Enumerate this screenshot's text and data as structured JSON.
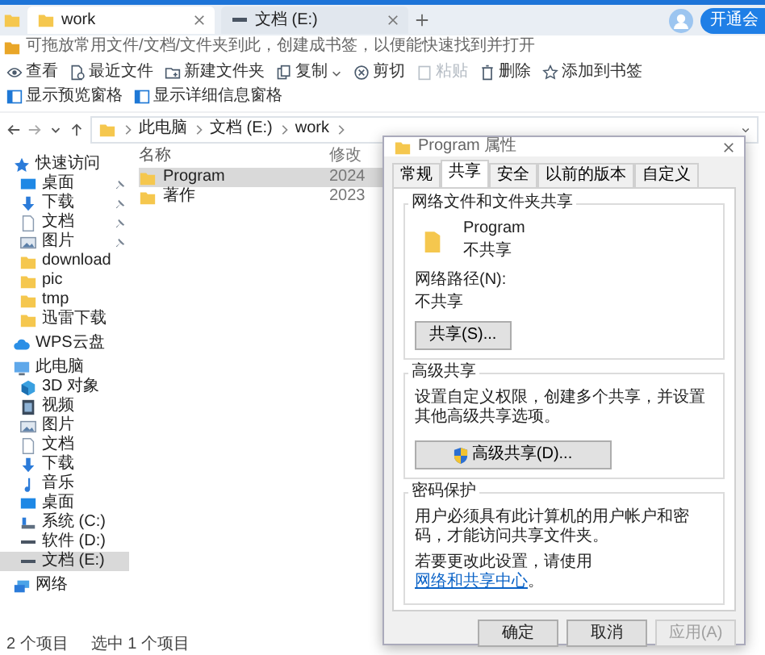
{
  "tabs": [
    {
      "label": "work",
      "selected": true,
      "kind": "folder"
    },
    {
      "label": "文档 (E:)",
      "selected": false,
      "kind": "drive"
    }
  ],
  "account_button": "开通会",
  "bookmark_hint": "可拖放常用文件/文档/文件夹到此，创建成书签，以便能快速找到并打开",
  "toolbar": [
    {
      "label": "查看",
      "kind": "eye",
      "disabled": false
    },
    {
      "label": "最近文件",
      "kind": "recent",
      "disabled": false
    },
    {
      "label": "新建文件夹",
      "kind": "newfolder",
      "disabled": false
    },
    {
      "label": "复制",
      "kind": "copy",
      "disabled": false
    },
    {
      "label": "剪切",
      "kind": "cut",
      "disabled": false
    },
    {
      "label": "粘贴",
      "kind": "paste",
      "disabled": true
    },
    {
      "label": "删除",
      "kind": "delete",
      "disabled": false
    },
    {
      "label": "添加到书签",
      "kind": "bookmark",
      "disabled": false
    },
    {
      "label": "显示预览窗格",
      "kind": "pane",
      "disabled": false
    },
    {
      "label": "显示详细信息窗格",
      "kind": "pane",
      "disabled": false
    }
  ],
  "breadcrumb": [
    "此电脑",
    "文档 (E:)",
    "work"
  ],
  "sidebar": [
    {
      "label": "快速访问",
      "kind": "star",
      "selected": false,
      "children": [
        {
          "label": "桌面",
          "kind": "desktop",
          "selected": false,
          "pinned": true
        },
        {
          "label": "下载",
          "kind": "download",
          "selected": false,
          "pinned": true
        },
        {
          "label": "文档",
          "kind": "document",
          "selected": false,
          "pinned": true
        },
        {
          "label": "图片",
          "kind": "picture",
          "selected": false,
          "pinned": true
        },
        {
          "label": "download",
          "kind": "folder",
          "selected": false,
          "pinned": false
        },
        {
          "label": "pic",
          "kind": "folder",
          "selected": false,
          "pinned": false
        },
        {
          "label": "tmp",
          "kind": "folder",
          "selected": false,
          "pinned": false
        },
        {
          "label": "迅雷下载",
          "kind": "folder",
          "selected": false,
          "pinned": false
        }
      ]
    },
    {
      "label": "WPS云盘",
      "kind": "cloud",
      "selected": false
    },
    {
      "label": "此电脑",
      "kind": "pc",
      "selected": false,
      "children": [
        {
          "label": "3D 对象",
          "kind": "cube",
          "selected": false
        },
        {
          "label": "视频",
          "kind": "video",
          "selected": false
        },
        {
          "label": "图片",
          "kind": "picture",
          "selected": false
        },
        {
          "label": "文档",
          "kind": "document",
          "selected": false
        },
        {
          "label": "下载",
          "kind": "download",
          "selected": false
        },
        {
          "label": "音乐",
          "kind": "music",
          "selected": false
        },
        {
          "label": "桌面",
          "kind": "desktop",
          "selected": false
        },
        {
          "label": "系统 (C:)",
          "kind": "system",
          "selected": false
        },
        {
          "label": "软件 (D:)",
          "kind": "drive",
          "selected": false
        },
        {
          "label": "文档 (E:)",
          "kind": "drive",
          "selected": true
        }
      ]
    },
    {
      "label": "网络",
      "kind": "network",
      "selected": false
    }
  ],
  "file_list": {
    "columns": [
      "名称",
      "修改"
    ],
    "rows": [
      {
        "name": "Program",
        "modified": "2024",
        "selected": true
      },
      {
        "name": "著作",
        "modified": "2023",
        "selected": false
      }
    ]
  },
  "status_bar": [
    "2 个项目",
    "选中 1 个项目"
  ],
  "dialog": {
    "title": "Program 属性",
    "tabs": [
      {
        "label": "常规",
        "selected": false
      },
      {
        "label": "共享",
        "selected": true
      },
      {
        "label": "安全",
        "selected": false
      },
      {
        "label": "以前的版本",
        "selected": false
      },
      {
        "label": "自定义",
        "selected": false
      }
    ],
    "sharing": {
      "heading": "网络文件和文件夹共享",
      "folder_name": "Program",
      "share_state": "不共享",
      "path_label": "网络路径(N):",
      "path_value": "不共享",
      "button": "共享(S)..."
    },
    "advanced": {
      "heading": "高级共享",
      "description": "设置自定义权限，创建多个共享，并设置其他高级共享选项。",
      "button": "高级共享(D)..."
    },
    "password": {
      "heading": "密码保护",
      "description": "用户必须具有此计算机的用户帐户和密码，才能访问共享文件夹。",
      "hint": "若要更改此设置，请使用",
      "link": "网络和共享中心",
      "hint_end": "。"
    },
    "buttons": [
      {
        "label": "确定",
        "disabled": false
      },
      {
        "label": "取消",
        "disabled": false
      },
      {
        "label": "应用(A)",
        "disabled": true
      }
    ]
  }
}
